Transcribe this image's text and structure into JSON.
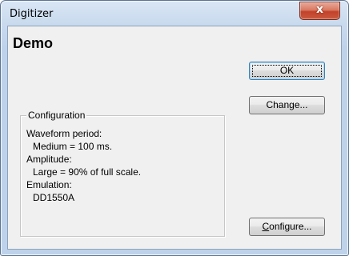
{
  "window": {
    "title": "Digitizer",
    "close_glyph": "x"
  },
  "dialog": {
    "heading": "Demo"
  },
  "configuration": {
    "legend": "Configuration",
    "lines": [
      "Waveform period:",
      "Medium = 100 ms.",
      "Amplitude:",
      "Large = 90% of full scale.",
      "Emulation:",
      "DD1550A"
    ]
  },
  "buttons": {
    "ok": "OK",
    "change": "Change...",
    "configure_accel": "C",
    "configure_rest": "onfigure..."
  },
  "colors": {
    "accent": "#3c7fb1",
    "close_button": "#c2412a",
    "client_bg": "#f0f0f0"
  }
}
